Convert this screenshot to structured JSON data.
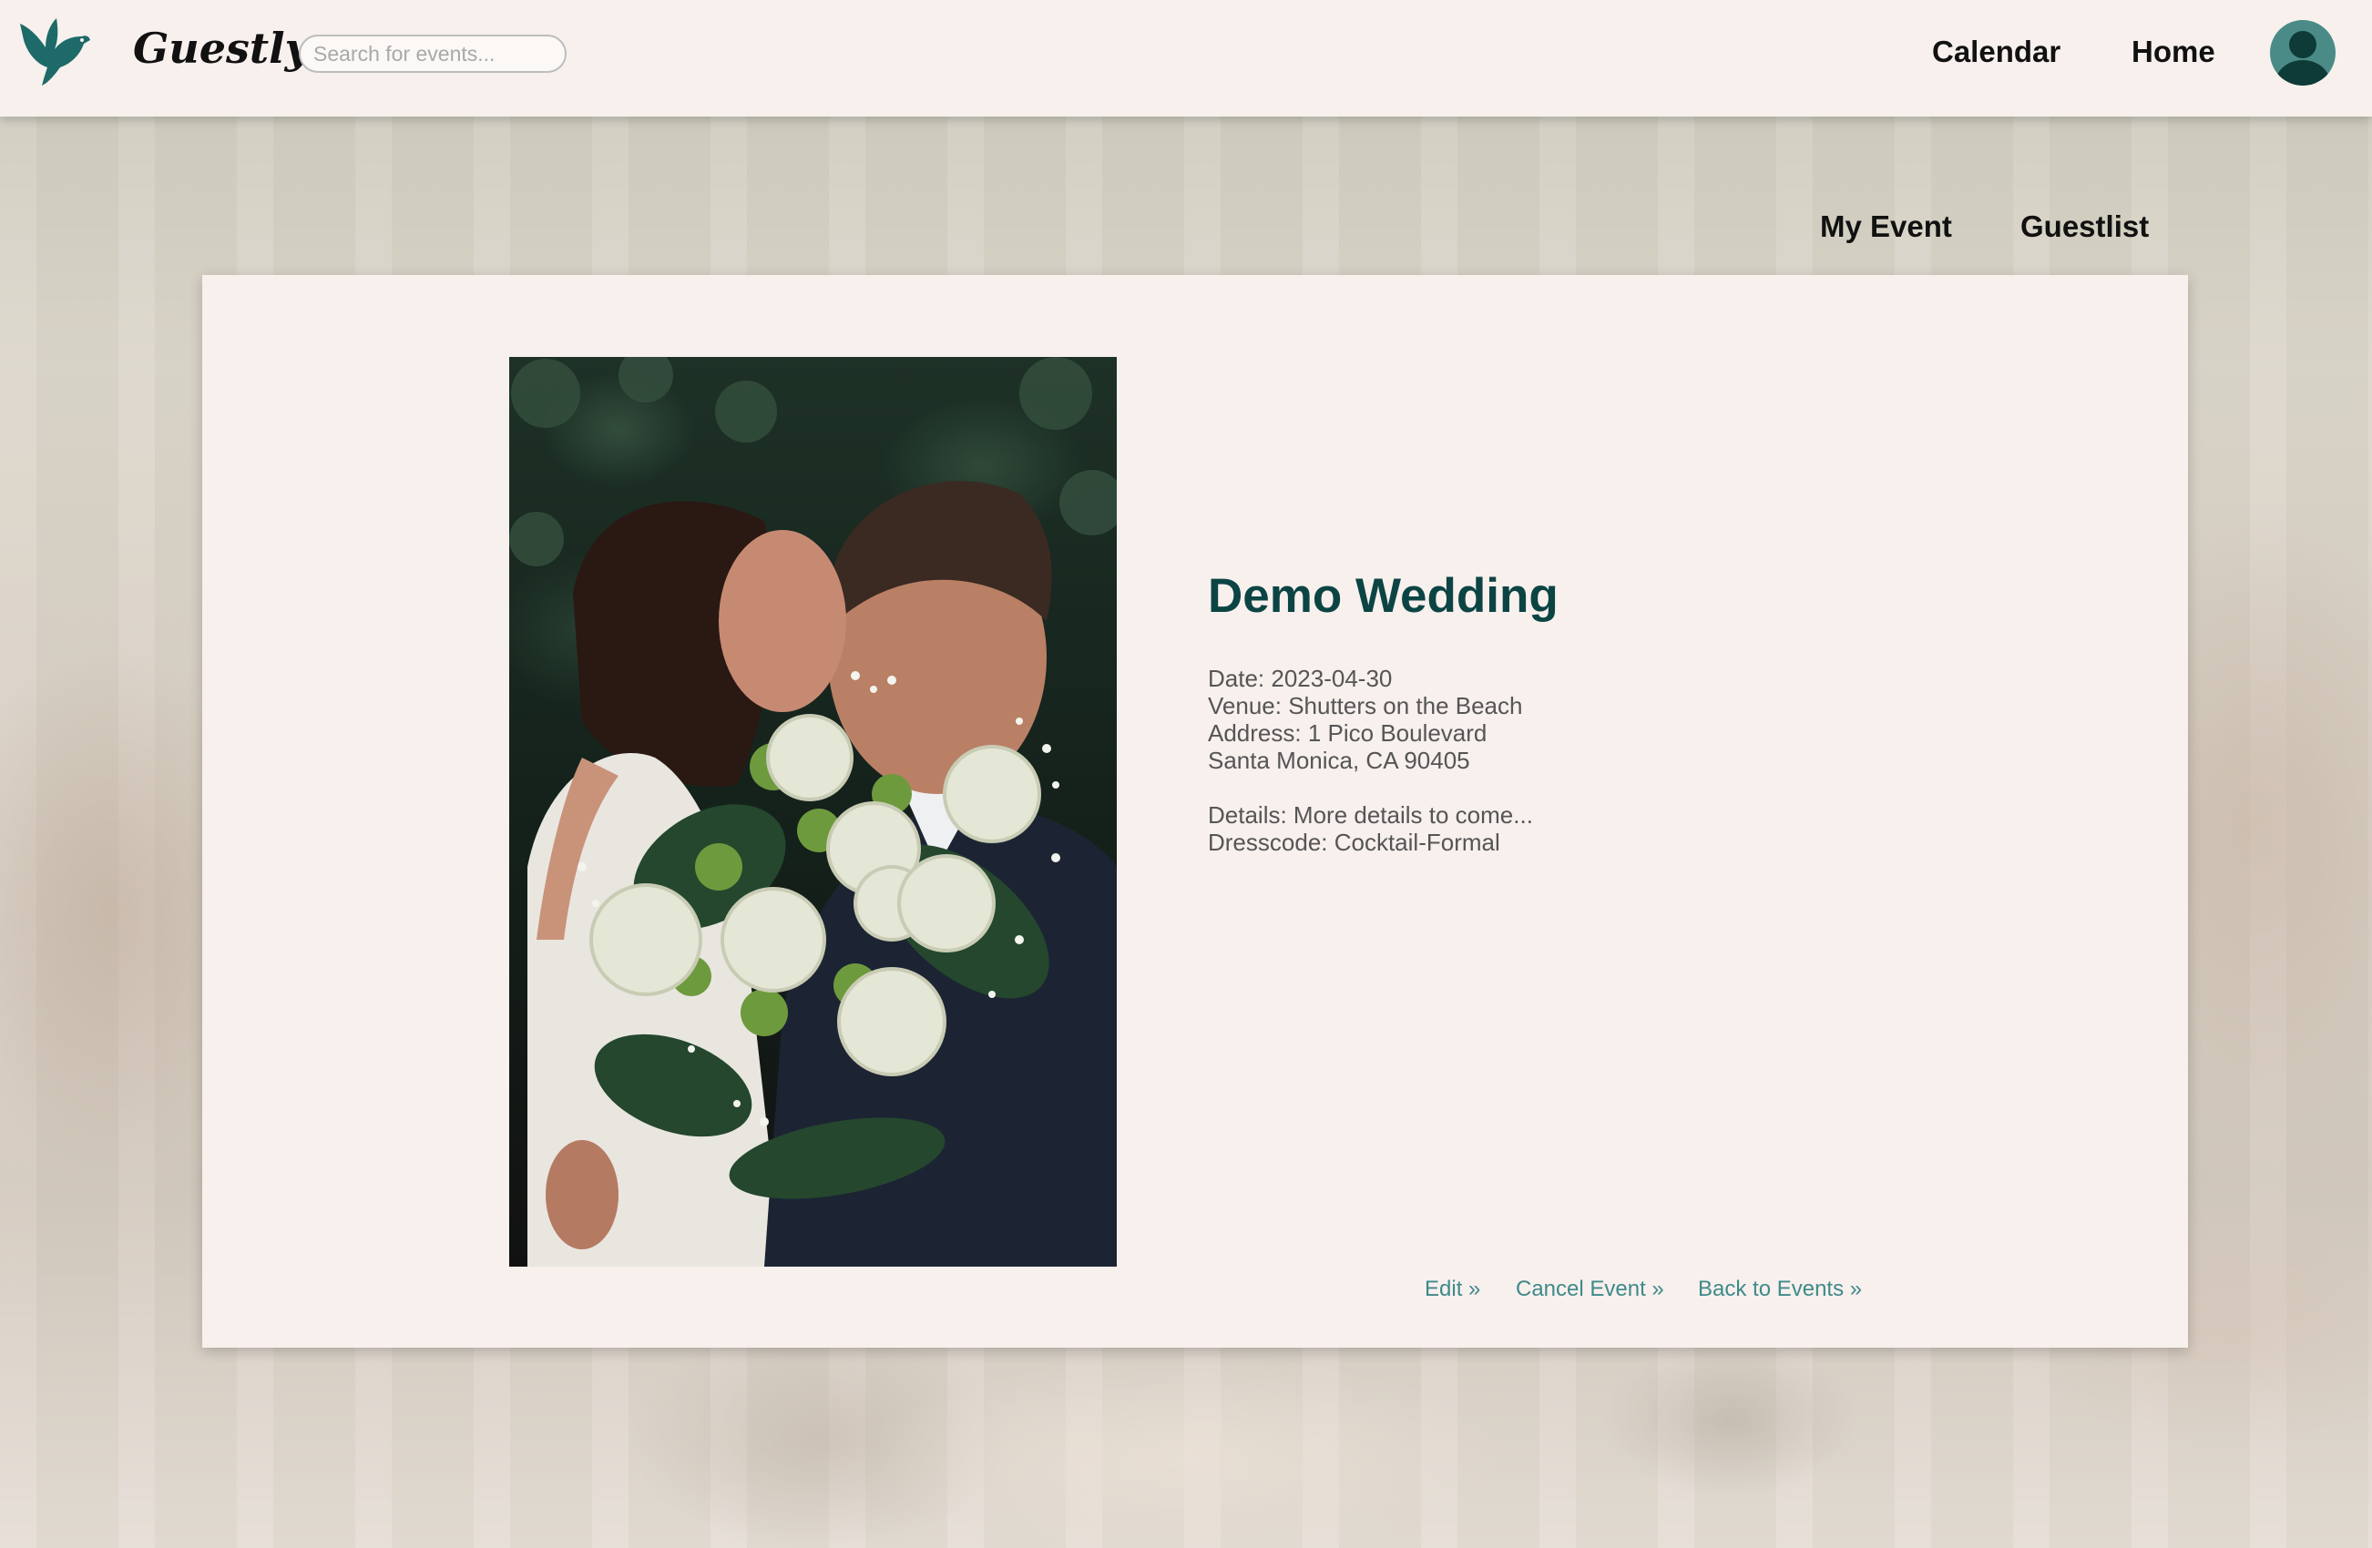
{
  "app": {
    "brand": "Guestly"
  },
  "search": {
    "placeholder": "Search for events..."
  },
  "nav": {
    "calendar": "Calendar",
    "home": "Home"
  },
  "tabs": {
    "my_event": "My Event",
    "guestlist": "Guestlist"
  },
  "event": {
    "title": "Demo Wedding",
    "date": "Date: 2023-04-30",
    "venue": "Venue: Shutters on the Beach",
    "address_line1": "Address: 1 Pico Boulevard",
    "address_line2": "Santa Monica, CA 90405",
    "details": "Details: More details to come...",
    "dresscode": "Dresscode: Cocktail-Formal"
  },
  "actions": {
    "edit": "Edit »",
    "cancel": "Cancel Event »",
    "back": "Back to Events »"
  },
  "icons": {
    "logo": "bird-logo-icon",
    "avatar": "user-avatar-icon"
  },
  "colors": {
    "accent": "#0c4444",
    "link": "#3f8a8a",
    "logo": "#1d6a69",
    "panel": "#f7f0ed"
  }
}
